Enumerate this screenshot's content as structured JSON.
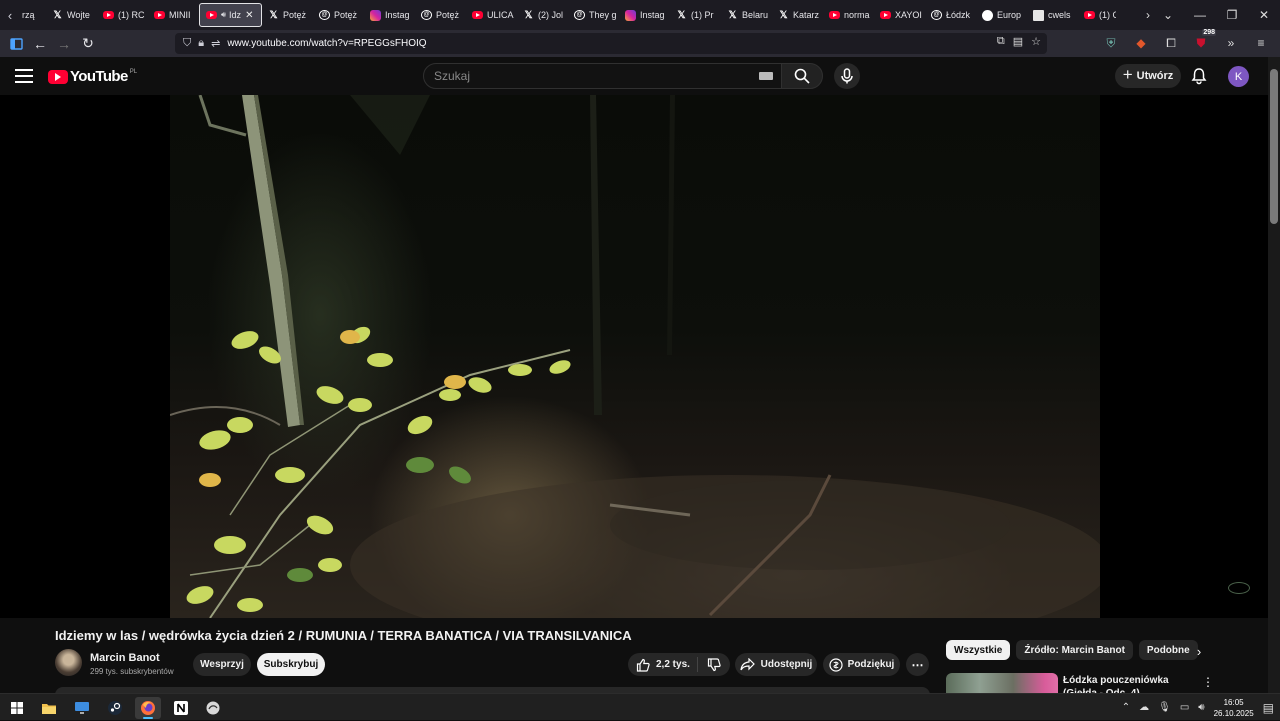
{
  "browser": {
    "tabs": [
      {
        "label": "rzą",
        "icon": "none"
      },
      {
        "label": "Wojte",
        "icon": "x"
      },
      {
        "label": "(1) RC",
        "icon": "youtube"
      },
      {
        "label": "MINII",
        "icon": "youtube"
      },
      {
        "label": "Idz",
        "icon": "youtube",
        "active": true
      },
      {
        "label": "Potęż",
        "icon": "x"
      },
      {
        "label": "Potęż",
        "icon": "threads"
      },
      {
        "label": "Instag",
        "icon": "instagram"
      },
      {
        "label": "Potęż",
        "icon": "threads"
      },
      {
        "label": "ULICA",
        "icon": "youtube"
      },
      {
        "label": "(2) Jol",
        "icon": "x"
      },
      {
        "label": "They g",
        "icon": "threads"
      },
      {
        "label": "Instag",
        "icon": "instagram"
      },
      {
        "label": "(1) Pr",
        "icon": "x"
      },
      {
        "label": "Belaru",
        "icon": "x"
      },
      {
        "label": "Katarz",
        "icon": "x"
      },
      {
        "label": "norma",
        "icon": "youtube"
      },
      {
        "label": "XAYOI",
        "icon": "youtube"
      },
      {
        "label": "Łódzk",
        "icon": "threads"
      },
      {
        "label": "Europ",
        "icon": "europe"
      },
      {
        "label": "cwels",
        "icon": "doc"
      },
      {
        "label": "(1) C",
        "icon": "youtube"
      }
    ],
    "url": "www.youtube.com/watch?v=RPEGGsFHOIQ",
    "extensions_badge": "298",
    "accent": "#42414d"
  },
  "youtube": {
    "logo_text": "YouTube",
    "country_code": "PL",
    "search_placeholder": "Szukaj",
    "create_label": "Utwórz",
    "avatar_letter": "K",
    "avatar_color": "#7e57c2"
  },
  "video": {
    "title": "Idziemy w las / wędrówka życia dzień 2 / RUMUNIA / TERRA BANATICA / VIA TRANSILVANICA",
    "channel_name": "Marcin Banot",
    "subscribers": "299 tys. subskrybentów",
    "join_label": "Wesprzyj",
    "subscribe_label": "Subskrybuj",
    "likes": "2,2 tys.",
    "share_label": "Udostępnij",
    "thanks_label": "Podziękuj"
  },
  "sidebar": {
    "chips": [
      {
        "label": "Wszystkie",
        "active": true
      },
      {
        "label": "Źródło: Marcin Banot",
        "active": false
      },
      {
        "label": "Podobne",
        "active": false
      }
    ],
    "recommendation_title": "Łódzka pouczeniówka (Giełda - Odc. 4)"
  },
  "taskbar": {
    "time": "16:05",
    "date": "26.10.2025"
  }
}
